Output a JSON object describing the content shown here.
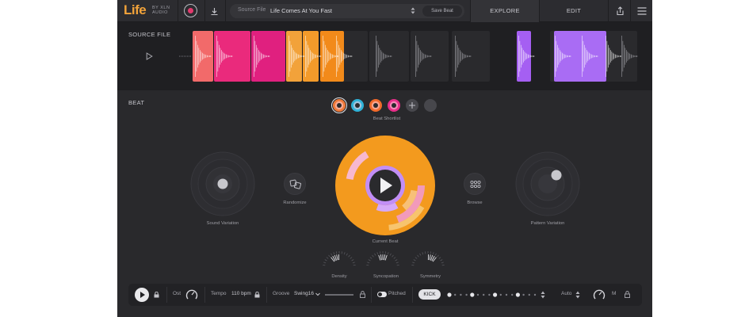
{
  "app": {
    "logo_text": "Life",
    "logo_sub_line1": "BY XLN",
    "logo_sub_line2": "AUDIO"
  },
  "topbar": {
    "source_label": "Source File",
    "source_value": "Life Comes At You Fast",
    "save_beat_label": "Save Beat",
    "tabs": [
      {
        "label": "EXPLORE",
        "active": true
      },
      {
        "label": "EDIT",
        "active": false
      }
    ],
    "icons": [
      "record-icon",
      "download-icon",
      "share-icon",
      "menu-icon"
    ],
    "record_color": "#e23a6e"
  },
  "source_section": {
    "title": "SOURCE FILE",
    "segment_colors": [
      "#f26a6a",
      "#ea2a7c",
      "#e0207f",
      "#f2a23a",
      "#f39a2a",
      "#f28a1a",
      "#a55ff2",
      "#a96cf4"
    ]
  },
  "beat_section": {
    "title": "BEAT",
    "shortlist_caption": "Beat Shortlist",
    "shortlist_colors": [
      "#f07a3a",
      "#2fb2d8",
      "#f26a2a",
      "#e82e8a"
    ],
    "sound_variation_label": "Sound Variation",
    "randomize_label": "Randomize",
    "current_beat_label": "Current Beat",
    "browse_label": "Browse",
    "pattern_variation_label": "Pattern Variation",
    "dials": [
      {
        "label": "Density"
      },
      {
        "label": "Syncopation"
      },
      {
        "label": "Symmetry"
      }
    ]
  },
  "bottombar": {
    "ost_label": "Ost",
    "tempo_label": "Tempo",
    "tempo_value": "110 bpm",
    "groove_label": "Groove",
    "groove_value": "Swing16",
    "pitched_label": "Pitched",
    "kick_label": "KICK",
    "auto_label": "Auto",
    "m_label": "M",
    "step_pattern": [
      1,
      0,
      0,
      0,
      1,
      0,
      0,
      0,
      1,
      0,
      0,
      0,
      1,
      0,
      0,
      0
    ]
  },
  "colors": {
    "accent_orange": "#f39a1e",
    "accent_pink": "#e8287e",
    "accent_purple": "#a560f2"
  }
}
